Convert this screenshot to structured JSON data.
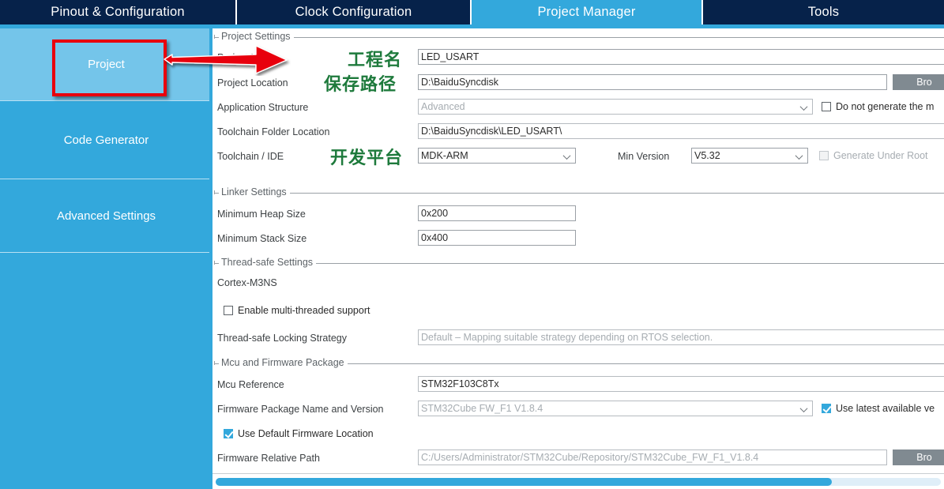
{
  "app": {
    "tabs": [
      {
        "label": "Pinout & Configuration",
        "active": false
      },
      {
        "label": "Clock Configuration",
        "active": false
      },
      {
        "label": "Project Manager",
        "active": true
      },
      {
        "label": "Tools",
        "active": false
      }
    ],
    "accent_color": "#33a8dc",
    "tabbar_color": "#06224a",
    "annotation_color": "#1e7a3c",
    "highlight_color": "#e8000d"
  },
  "sidebar": {
    "items": [
      {
        "label": "Project",
        "selected": true
      },
      {
        "label": "Code Generator",
        "selected": false
      },
      {
        "label": "Advanced Settings",
        "selected": false
      },
      {
        "label": "",
        "selected": false
      }
    ]
  },
  "project_settings": {
    "title": "Project Settings",
    "project_name": {
      "label": "Project Name",
      "value": "LED_USART"
    },
    "project_location": {
      "label": "Project Location",
      "value": "D:\\BaiduSyncdisk",
      "browse": "Bro"
    },
    "application_structure": {
      "label": "Application Structure",
      "value": "Advanced"
    },
    "do_not_generate_main": {
      "label": "Do not generate the m",
      "checked": false
    },
    "toolchain_folder_location": {
      "label": "Toolchain Folder Location",
      "value": "D:\\BaiduSyncdisk\\LED_USART\\"
    },
    "toolchain_ide": {
      "label": "Toolchain / IDE",
      "value": "MDK-ARM"
    },
    "min_version": {
      "label": "Min Version",
      "value": "V5.32"
    },
    "generate_under_root": {
      "label": "Generate Under Root",
      "checked": false
    }
  },
  "linker_settings": {
    "title": "Linker Settings",
    "minimum_heap_size": {
      "label": "Minimum Heap Size",
      "value": "0x200"
    },
    "minimum_stack_size": {
      "label": "Minimum Stack Size",
      "value": "0x400"
    }
  },
  "thread_safe_settings": {
    "title": "Thread-safe Settings",
    "core_label": "Cortex-M3NS",
    "enable_multithreaded": {
      "label": "Enable multi-threaded support",
      "checked": false
    },
    "locking_strategy": {
      "label": "Thread-safe Locking Strategy",
      "value": "Default – Mapping suitable strategy depending on RTOS selection."
    }
  },
  "mcu_firmware_package": {
    "title": "Mcu and Firmware Package",
    "mcu_reference": {
      "label": "Mcu Reference",
      "value": "STM32F103C8Tx"
    },
    "firmware_package": {
      "label": "Firmware Package Name and Version",
      "value": "STM32Cube FW_F1 V1.8.4"
    },
    "use_latest_version": {
      "label": "Use latest available ve",
      "checked": true
    },
    "use_default_firmware_location": {
      "label": "Use Default Firmware Location",
      "checked": true
    },
    "firmware_relative_path": {
      "label": "Firmware Relative Path",
      "value": "C:/Users/Administrator/STM32Cube/Repository/STM32Cube_FW_F1_V1.8.4",
      "browse": "Bro"
    }
  },
  "annotations": [
    {
      "text": "工程名"
    },
    {
      "text": "保存路径"
    },
    {
      "text": "开发平台"
    }
  ],
  "scrollbar": {
    "thumb_percent": 85
  }
}
